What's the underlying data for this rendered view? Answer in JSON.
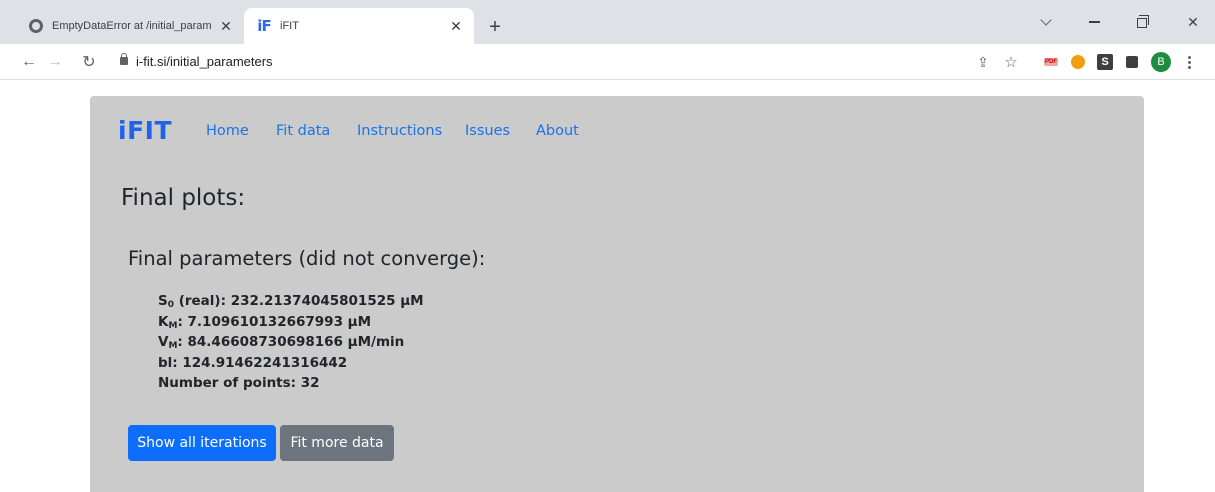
{
  "browser": {
    "tabs": [
      {
        "title": "EmptyDataError at /initial_param",
        "favicon": "globe-icon",
        "active": false
      },
      {
        "title": "iFIT",
        "favicon": "ifit-favicon",
        "favicon_text": "iF",
        "active": true
      }
    ],
    "new_tab_symbol": "+",
    "close_symbol": "✕",
    "url": "i-fit.si/initial_parameters",
    "profile_initial": "B",
    "ext_s_label": "S",
    "ext_pdf_label": "PDF"
  },
  "site": {
    "brand": "iFIT",
    "nav": [
      {
        "label": "Home"
      },
      {
        "label": "Fit data"
      },
      {
        "label": "Instructions"
      },
      {
        "label": "Issues"
      },
      {
        "label": "About"
      }
    ]
  },
  "content": {
    "heading": "Final plots:",
    "subheading": "Final parameters (did not converge):",
    "params": {
      "s0": {
        "sym": "S",
        "sub": "0",
        "rest": " (real): 232.21374045801525 µM"
      },
      "km": {
        "sym": "K",
        "sub": "M",
        "rest": ": 7.109610132667993 µM"
      },
      "vm": {
        "sym": "V",
        "sub": "M",
        "rest": ": 84.46608730698166 µM/min"
      },
      "bl": "bl: 124.91462241316442",
      "points": "Number of points: 32"
    },
    "buttons": {
      "show_all": "Show all iterations",
      "fit_more": "Fit more data"
    }
  },
  "colors": {
    "brand": "#1e63e9",
    "link": "#1a73e8",
    "primary_button": "#0d6efd",
    "secondary_button": "#6c757d",
    "page_background": "#cbcbcb"
  }
}
